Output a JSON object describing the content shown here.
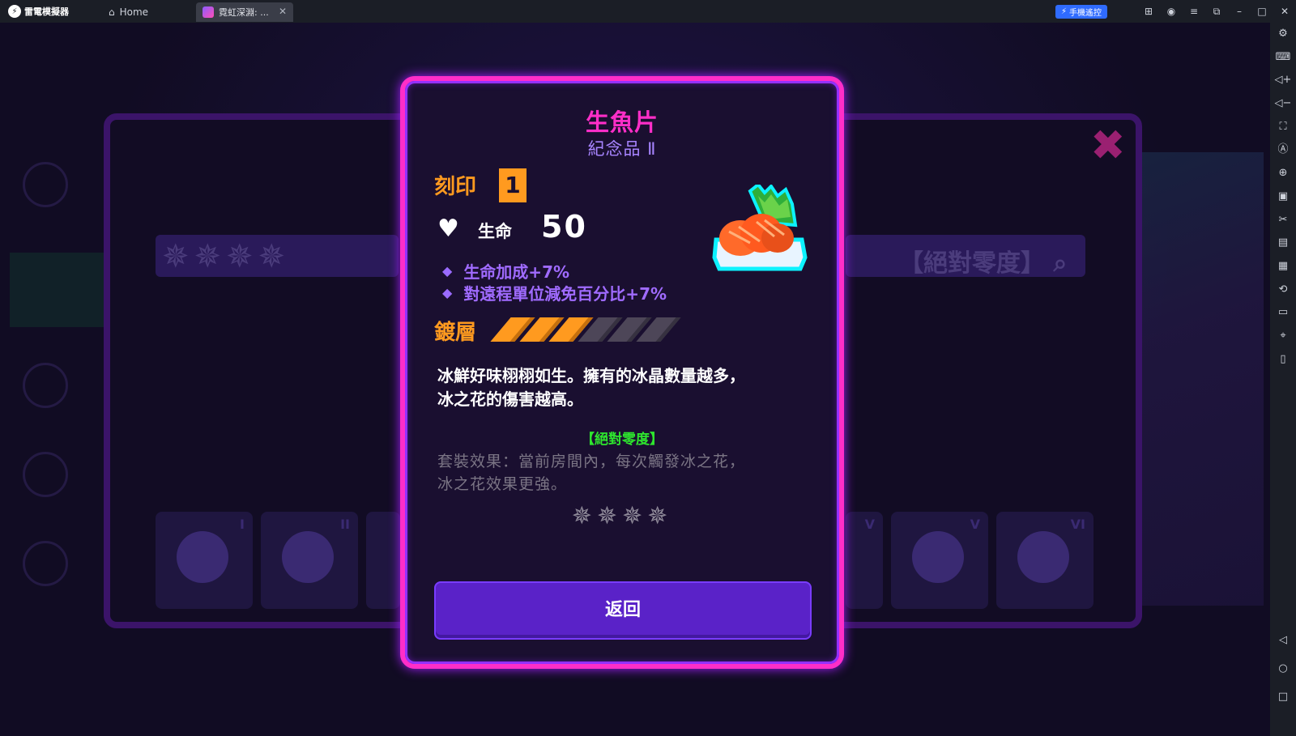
{
  "app": {
    "brand": "雷電模擬器",
    "tabs": [
      {
        "label": "Home",
        "icon": "home-icon"
      },
      {
        "label": "霓虹深淵: ...",
        "icon": "game-icon"
      }
    ],
    "remote_label": "手機遙控",
    "titlebar_icons": [
      "gamepad-icon",
      "account-icon",
      "menu-icon",
      "expand-icon",
      "minimize-icon",
      "maximize-icon",
      "close-icon"
    ],
    "sidebar_icons": [
      "settings-icon",
      "keyboard-icon",
      "volume-up-icon",
      "volume-down-icon",
      "screenshot-icon",
      "auto-icon",
      "add-window-icon",
      "apk-icon",
      "scissors-icon",
      "multi-instance-icon",
      "record-icon",
      "sync-icon",
      "folder-icon",
      "location-icon",
      "shake-icon",
      "back-icon",
      "home-circle-icon",
      "recent-apps-icon"
    ]
  },
  "background": {
    "set_label": "【絕對零度】",
    "slot_numbers": [
      "I",
      "II",
      "V",
      "V",
      "VI"
    ]
  },
  "dialog": {
    "item_name": "生魚片",
    "item_category": "紀念品 Ⅱ",
    "imprint_label": "刻印",
    "imprint_level": "1",
    "stat": {
      "label": "生命",
      "value": "50"
    },
    "bonuses": [
      "生命加成+7%",
      "對遠程單位減免百分比+7%"
    ],
    "plating_label": "鍍層",
    "plating": {
      "filled": 3,
      "total": 6
    },
    "description_lines": [
      "冰鮮好味栩栩如生。擁有的冰晶數量越多，",
      "冰之花的傷害越高。"
    ],
    "set_name": "【絕對零度】",
    "set_effect_lines": [
      "套裝效果：當前房間內，每次觸發冰之花，",
      "冰之花效果更強。"
    ],
    "set_stars": "✵✵✵✵",
    "back_label": "返回"
  },
  "colors": {
    "frame": "#ff2ec8",
    "title": "#ff2ec8",
    "category": "#a784ff",
    "accent_orange": "#ff9a1f",
    "bonus_purple": "#a06bff",
    "set_green": "#2ee52e",
    "button": "#5a22c8"
  }
}
